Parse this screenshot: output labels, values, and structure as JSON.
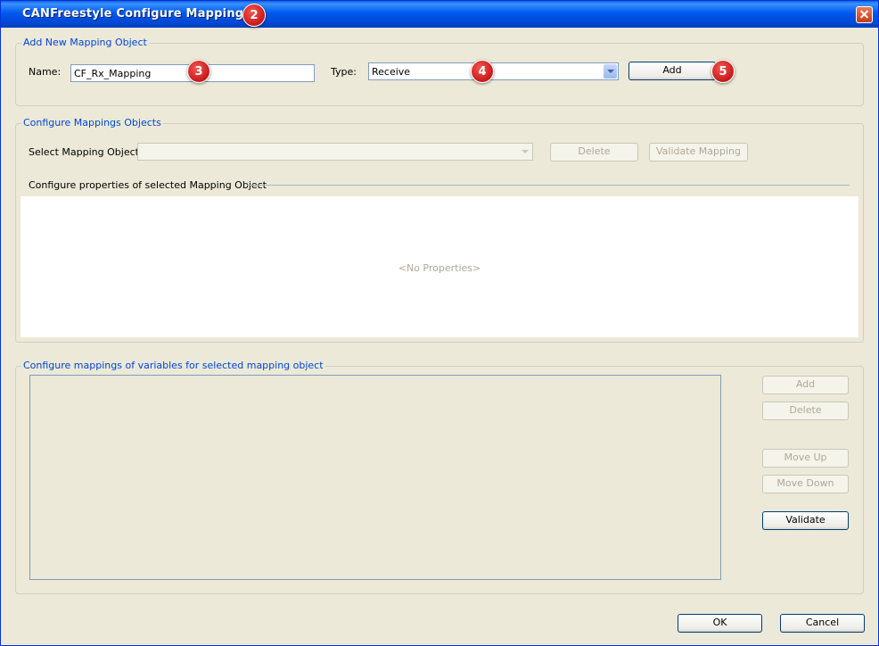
{
  "window": {
    "title": "CANFreestyle Configure Mappings"
  },
  "badges": [
    "2",
    "3",
    "4",
    "5"
  ],
  "add_group": {
    "legend": "Add New Mapping Object",
    "name_label": "Name:",
    "name_value": "CF_Rx_Mapping",
    "type_label": "Type:",
    "type_value": "Receive",
    "add_label": "Add"
  },
  "configure_group": {
    "legend": "Configure Mappings Objects",
    "select_label": "Select Mapping Object:",
    "select_value": "",
    "delete_label": "Delete",
    "validate_label": "Validate Mapping",
    "props_heading": "Configure properties of selected Mapping Object",
    "no_props": "<No Properties>"
  },
  "variables_group": {
    "legend": "Configure mappings of variables for selected mapping object",
    "add_label": "Add",
    "delete_label": "Delete",
    "move_up_label": "Move Up",
    "move_down_label": "Move Down",
    "validate_label": "Validate"
  },
  "footer": {
    "ok_label": "OK",
    "cancel_label": "Cancel"
  }
}
